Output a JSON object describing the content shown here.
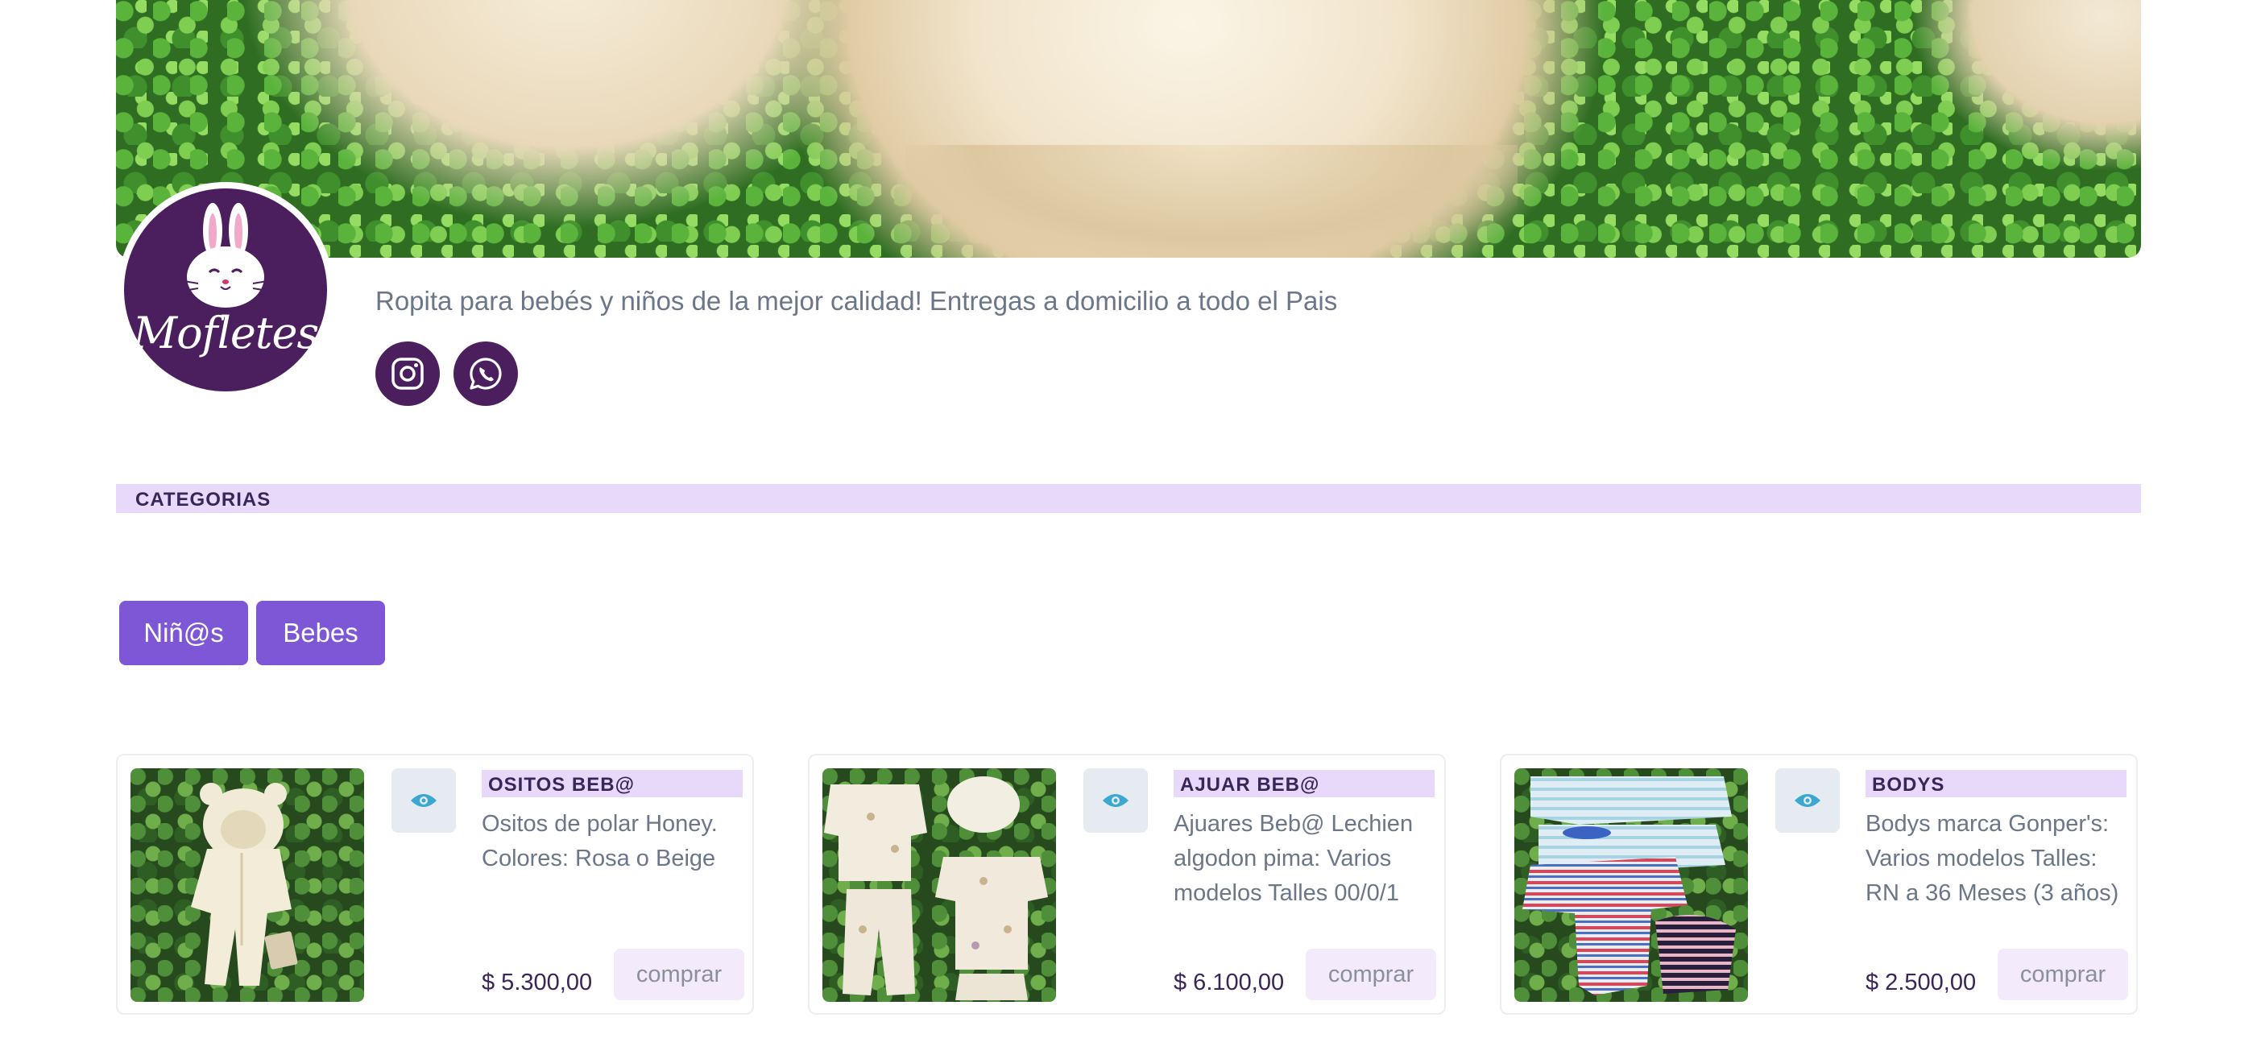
{
  "store": {
    "logo_text": "Mofletes",
    "tagline": "Ropita para bebés y niños de la mejor calidad! Entregas a domicilio a todo el Pais",
    "social": [
      {
        "name": "instagram",
        "icon": "instagram-icon"
      },
      {
        "name": "whatsapp",
        "icon": "whatsapp-icon"
      }
    ]
  },
  "categories": {
    "header": "CATEGORIAS",
    "buttons": [
      "Niñ@s",
      "Bebes"
    ]
  },
  "products": [
    {
      "category": "OSITOS BEB@",
      "description": "Ositos de polar Honey. Colores: Rosa o Beige",
      "price": "$ 5.300,00",
      "buy_label": "comprar"
    },
    {
      "category": "AJUAR BEB@",
      "description": "Ajuares Beb@ Lechien algodon pima: Varios modelos Talles 00/0/1",
      "price": "$ 6.100,00",
      "buy_label": "comprar"
    },
    {
      "category": "BODYS",
      "description": "Bodys marca Gonper's: Varios modelos Talles: RN a 36 Meses (3 años)",
      "price": "$ 2.500,00",
      "buy_label": "comprar"
    }
  ],
  "colors": {
    "brand_purple": "#4b1f5e",
    "button_purple": "#7e57d6",
    "tag_lavender": "#e8d9fa",
    "eye_icon": "#3aa8cf"
  }
}
